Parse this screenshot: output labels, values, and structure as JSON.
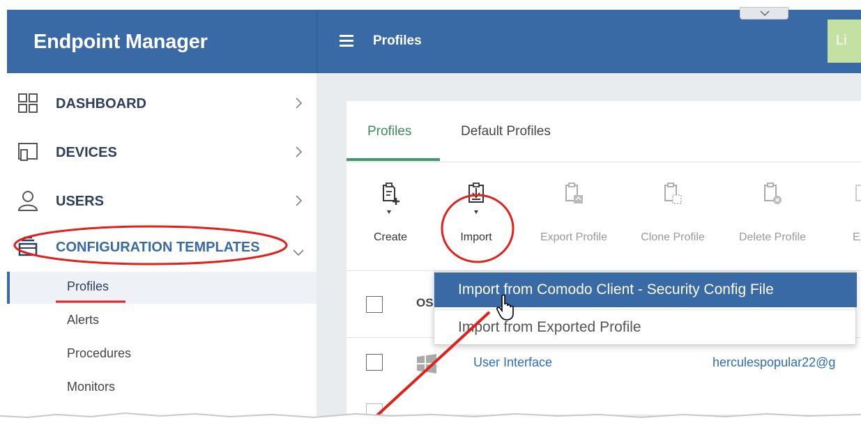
{
  "app": {
    "title": "Endpoint Manager"
  },
  "header": {
    "title": "Profiles",
    "license_button_partial": "Li"
  },
  "sidebar": {
    "items": [
      {
        "label": "DASHBOARD",
        "icon": "dashboard-grid-icon"
      },
      {
        "label": "DEVICES",
        "icon": "devices-icon"
      },
      {
        "label": "USERS",
        "icon": "user-icon"
      },
      {
        "label": "CONFIGURATION TEMPLATES",
        "icon": "stack-icon"
      }
    ],
    "subitems": [
      {
        "label": "Profiles"
      },
      {
        "label": "Alerts"
      },
      {
        "label": "Procedures"
      },
      {
        "label": "Monitors"
      }
    ]
  },
  "tabs": [
    {
      "label": "Profiles",
      "active": true
    },
    {
      "label": "Default Profiles",
      "active": false
    }
  ],
  "toolbar": {
    "create": "Create",
    "import": "Import",
    "export_profile": "Export Profile",
    "clone_profile": "Clone Profile",
    "delete_profile": "Delete Profile",
    "partial": "Ex"
  },
  "table": {
    "os_header": "OS",
    "rows": [
      {
        "name": "User Interface",
        "owner": "herculespopular22@g",
        "os": "windows-icon"
      }
    ]
  },
  "import_menu": {
    "items": [
      {
        "label": "Import from Comodo Client - Security Config File",
        "highlighted": true
      },
      {
        "label": "Import from Exported Profile",
        "highlighted": false
      }
    ]
  },
  "colors": {
    "brand": "#3a6aa5",
    "active_tab": "#3d8b5a",
    "annotation": "#e0201a",
    "link": "#2d6db3"
  }
}
